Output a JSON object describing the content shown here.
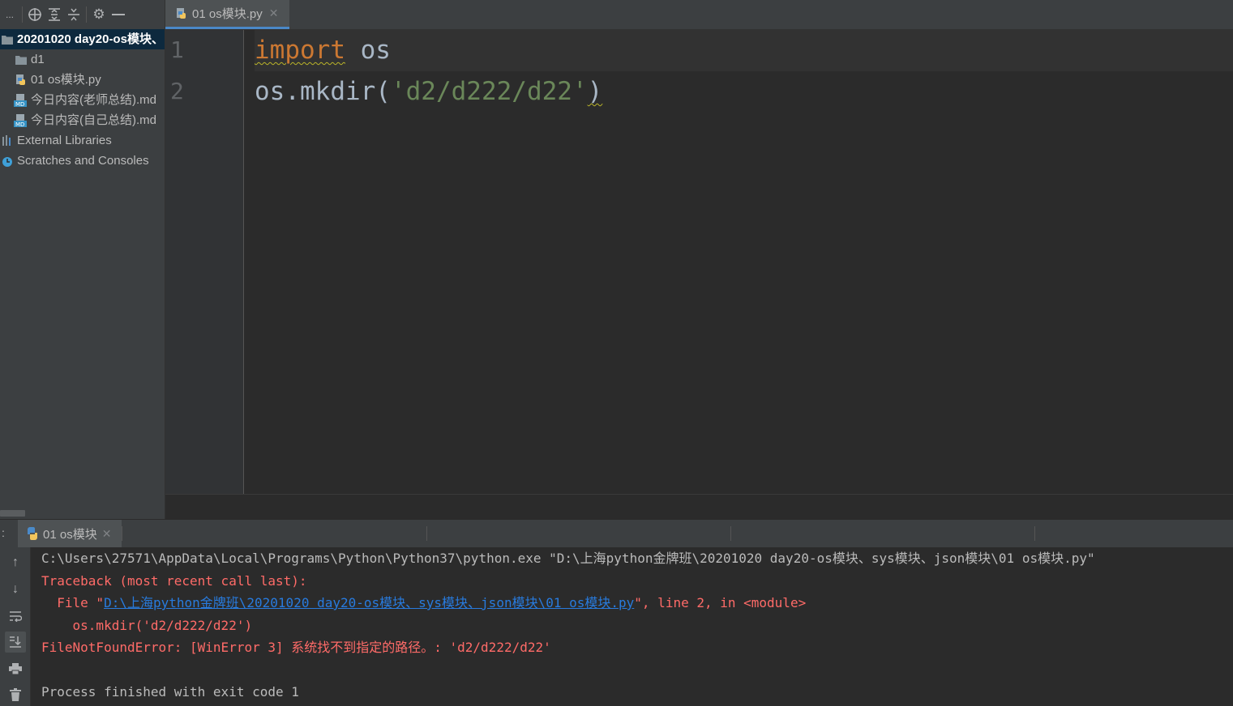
{
  "project": {
    "toolbar_ellipsis": "...",
    "tree": [
      {
        "label": "20201020 day20-os模块、",
        "icon": "folder-icon"
      },
      {
        "label": "d1",
        "icon": "folder-icon"
      },
      {
        "label": "01 os模块.py",
        "icon": "python-file-icon"
      },
      {
        "label": "今日内容(老师总结).md",
        "icon": "markdown-file-icon"
      },
      {
        "label": "今日内容(自己总结).md",
        "icon": "markdown-file-icon"
      },
      {
        "label": "External Libraries",
        "icon": "library-icon"
      },
      {
        "label": "Scratches and Consoles",
        "icon": "scratches-icon"
      }
    ]
  },
  "editor": {
    "tab_label": "01 os模块.py",
    "line_numbers": [
      "1",
      "2"
    ],
    "lines": {
      "l1_kw": "import",
      "l1_rest": " os",
      "l2_pre": "os.mkdir(",
      "l2_str_open": "'d2/d222/d22'",
      "l2_close": ")"
    }
  },
  "run": {
    "label": ":",
    "tab_label": "01 os模块",
    "console": {
      "cmd": "C:\\Users\\27571\\AppData\\Local\\Programs\\Python\\Python37\\python.exe \"D:\\上海python金牌班\\20201020 day20-os模块、sys模块、json模块\\01 os模块.py\"",
      "traceback": "Traceback (most recent call last):",
      "file_prefix": "  File \"",
      "file_link": "D:\\上海python金牌班\\20201020 day20-os模块、sys模块、json模块\\01 os模块.py",
      "file_suffix": "\", line 2, in <module>",
      "code_echo": "    os.mkdir('d2/d222/d22')",
      "error": "FileNotFoundError: [WinError 3] 系统找不到指定的路径。: 'd2/d222/d22'",
      "exit": "Process finished with exit code 1"
    }
  },
  "colors": {
    "keyword": "#cc7832",
    "string": "#6a8759",
    "error": "#ff6b68",
    "link": "#287bde"
  }
}
